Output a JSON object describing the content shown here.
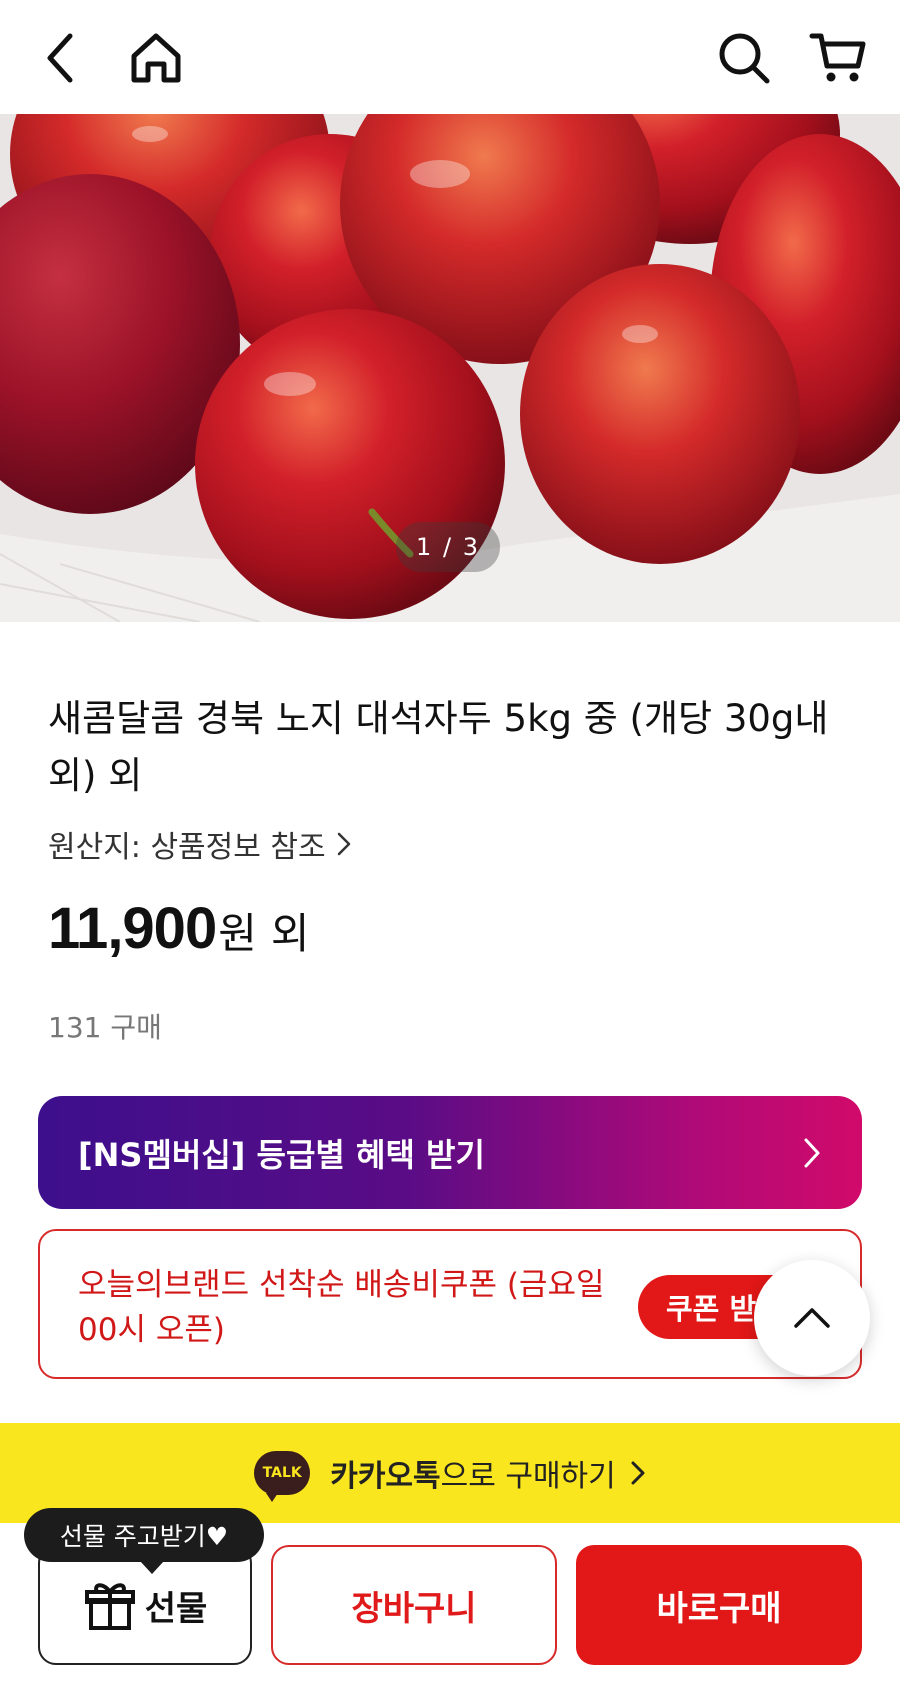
{
  "header": {
    "back_icon": "back-arrow-icon",
    "home_icon": "home-icon",
    "search_icon": "search-icon",
    "cart_icon": "cart-icon"
  },
  "gallery": {
    "current": "1",
    "separator": "/",
    "total": "3"
  },
  "product": {
    "title": "새콤달콤 경북 노지 대석자두 5kg 중 (개당 30g내외) 외",
    "origin_label": "원산지: 상품정보 참조",
    "price_value": "11,900",
    "price_unit": "원",
    "price_suffix": "외",
    "sold_count": "131 구매"
  },
  "membership": {
    "label": "[NS멤버십] 등급별 혜택 받기"
  },
  "coupon": {
    "text": "오늘의브랜드 선착순 배송비쿠폰 (금요일 00시 오픈)",
    "button_label": "쿠폰 받기"
  },
  "kakao": {
    "badge": "TALK",
    "brand": "카카오톡",
    "rest": "으로 구매하기"
  },
  "bottom": {
    "tooltip": "선물 주고받기♥",
    "gift_label": "선물",
    "cart_label": "장바구니",
    "buy_label": "바로구매"
  },
  "colors": {
    "accent_red": "#e21717",
    "kakao_yellow": "#fae61e",
    "membership_gradient_start": "#3d0f8c",
    "membership_gradient_end": "#d10a6a"
  }
}
